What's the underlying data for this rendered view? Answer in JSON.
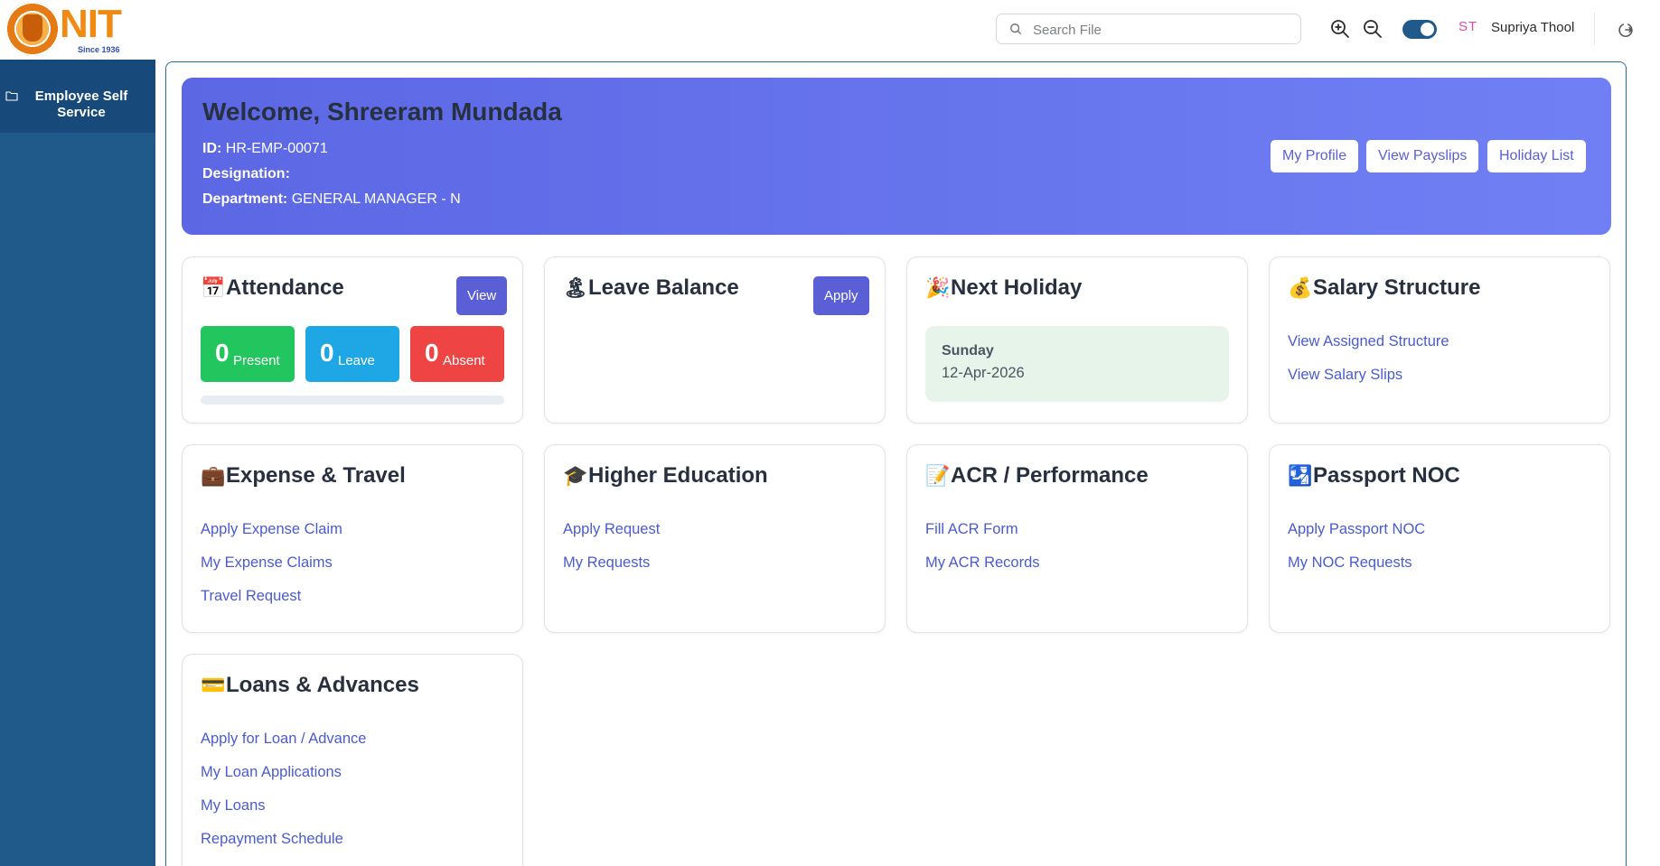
{
  "header": {
    "brand": "NIT",
    "since": "Since 1936",
    "search_placeholder": "Search File",
    "avatar_initials": "ST",
    "user_name": "Supriya Thool",
    "icons": [
      "search-icon",
      "zoom-in-icon",
      "zoom-out-icon",
      "theme-toggle",
      "logout-icon"
    ],
    "colors": {
      "toggle": "#1f5a8a",
      "avatar": "#e04aa6"
    }
  },
  "sidebar": {
    "items": [
      {
        "label": "Employee Self Service",
        "icon": "folder-icon"
      }
    ],
    "colors": {
      "background": "#1f5a8a",
      "active": "#17497a"
    }
  },
  "welcome": {
    "title": "Welcome, Shreeram Mundada",
    "id_label": "ID:",
    "id_value": "HR-EMP-00071",
    "designation_label": "Designation:",
    "designation_value": "",
    "department_label": "Department:",
    "department_value": "GENERAL MANAGER - N",
    "buttons": [
      "My Profile",
      "View Payslips",
      "Holiday List"
    ],
    "colors": {
      "gradient_start": "#5c67e4",
      "gradient_end": "#7080f4"
    }
  },
  "cards": {
    "attendance": {
      "emoji": "📅",
      "title": "Attendance",
      "button": "View",
      "stats": [
        {
          "value": "0",
          "label": "Present",
          "color": "#22c55e"
        },
        {
          "value": "0",
          "label": "Leave",
          "color": "#1ea7e4"
        },
        {
          "value": "0",
          "label": "Absent",
          "color": "#ef4444"
        }
      ]
    },
    "leave": {
      "emoji": "🏝",
      "title": "Leave Balance",
      "button": "Apply"
    },
    "holiday": {
      "emoji": "🎉",
      "title": "Next Holiday",
      "day": "Sunday",
      "date": "12-Apr-2026"
    },
    "salary": {
      "emoji": "💰",
      "title": "Salary Structure",
      "links": [
        "View Assigned Structure",
        "View Salary Slips"
      ]
    },
    "expense": {
      "emoji": "💼",
      "title": "Expense & Travel",
      "links": [
        "Apply Expense Claim",
        "My Expense Claims",
        "Travel Request"
      ]
    },
    "education": {
      "emoji": "🎓",
      "title": "Higher Education",
      "links": [
        "Apply Request",
        "My Requests"
      ]
    },
    "acr": {
      "emoji": "📝",
      "title": "ACR / Performance",
      "links": [
        "Fill ACR Form",
        "My ACR Records"
      ]
    },
    "passport": {
      "emoji": "🛂",
      "title": "Passport NOC",
      "links": [
        "Apply Passport NOC",
        "My NOC Requests"
      ]
    },
    "loans": {
      "emoji": "💳",
      "title": "Loans & Advances",
      "links": [
        "Apply for Loan / Advance",
        "My Loan Applications",
        "My Loans",
        "Repayment Schedule"
      ]
    }
  },
  "colors": {
    "link": "#4a5bd0",
    "primary_button": "#5a5fd6"
  }
}
